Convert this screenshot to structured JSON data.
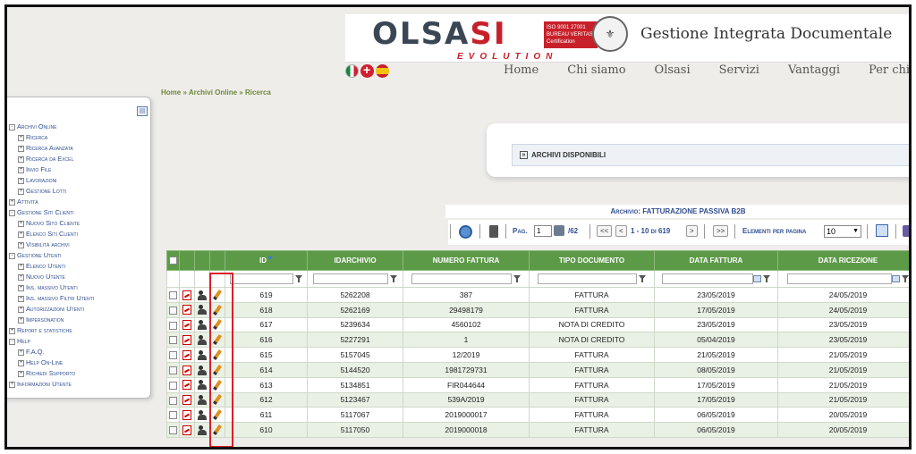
{
  "header": {
    "logo_main": "OLSA",
    "logo_accent": "SI",
    "logo_sub": "EVOLUTION",
    "cert_text": "ISO 9001 27001 BUREAU VERITAS Certification",
    "app_title": "Gestione Integrata Documentale"
  },
  "nav": {
    "items": [
      "Home",
      "Chi siamo",
      "Olsasi",
      "Servizi",
      "Vantaggi",
      "Per chi"
    ]
  },
  "breadcrumb": "Home » Archivi Online » Ricerca",
  "sidebar": {
    "items": [
      {
        "label": "Archivi Online",
        "level": 0,
        "sign": "-"
      },
      {
        "label": "Ricerca",
        "level": 1,
        "sign": "+"
      },
      {
        "label": "Ricerca Avanzata",
        "level": 1,
        "sign": "+"
      },
      {
        "label": "Ricerca da Excel",
        "level": 1,
        "sign": "+"
      },
      {
        "label": "Invio File",
        "level": 1,
        "sign": "+"
      },
      {
        "label": "Lavorazioni",
        "level": 1,
        "sign": "+"
      },
      {
        "label": "Gestione Lotti",
        "level": 1,
        "sign": "+"
      },
      {
        "label": "Attività",
        "level": 0,
        "sign": "+"
      },
      {
        "label": "Gestione Siti Clienti",
        "level": 0,
        "sign": "-"
      },
      {
        "label": "Nuovo Sito Cliente",
        "level": 1,
        "sign": "+"
      },
      {
        "label": "Elenco Siti Clienti",
        "level": 1,
        "sign": "+"
      },
      {
        "label": "Visibilità archivi",
        "level": 1,
        "sign": "+"
      },
      {
        "label": "Gestione Utenti",
        "level": 0,
        "sign": "-"
      },
      {
        "label": "Elenco Utenti",
        "level": 1,
        "sign": "+"
      },
      {
        "label": "Nuovo Utente",
        "level": 1,
        "sign": "+"
      },
      {
        "label": "Ins. massivo Utenti",
        "level": 1,
        "sign": "+"
      },
      {
        "label": "Ins. massivo Filtri Utenti",
        "level": 1,
        "sign": "+"
      },
      {
        "label": "Autorizzazioni Utenti",
        "level": 1,
        "sign": "+"
      },
      {
        "label": "Impersonation",
        "level": 1,
        "sign": "+"
      },
      {
        "label": "Report e statistiche",
        "level": 0,
        "sign": "+"
      },
      {
        "label": "Help",
        "level": 0,
        "sign": "-"
      },
      {
        "label": "F.A.Q.",
        "level": 1,
        "sign": "+"
      },
      {
        "label": "Help On-Line",
        "level": 1,
        "sign": "+"
      },
      {
        "label": "Richiedi Supporto",
        "level": 1,
        "sign": "+"
      },
      {
        "label": "Informazioni Utente",
        "level": 0,
        "sign": "+"
      }
    ]
  },
  "archivi": {
    "label": "ARCHIVI DISPONIBILI"
  },
  "archive_selected": {
    "prefix": "Archivio:",
    "name": "FATTURAZIONE PASSIVA B2B"
  },
  "pager": {
    "pag_label": "Pag.",
    "page": "1",
    "total_pages": "/62",
    "first": "<<",
    "prev": "<",
    "range": "1 - 10 di 619",
    "next": ">",
    "last": ">>",
    "per_page_label": "Elementi per pagina",
    "per_page": "10"
  },
  "table": {
    "columns": [
      "ID",
      "IDARCHIVIO",
      "NUMERO FATTURA",
      "TIPO DOCUMENTO",
      "DATA FATTURA",
      "DATA RICEZIONE"
    ],
    "rows": [
      [
        "619",
        "5262208",
        "387",
        "FATTURA",
        "23/05/2019",
        "24/05/2019"
      ],
      [
        "618",
        "5262169",
        "29498179",
        "FATTURA",
        "17/05/2019",
        "24/05/2019"
      ],
      [
        "617",
        "5239634",
        "4560102",
        "NOTA DI CREDITO",
        "23/05/2019",
        "23/05/2019"
      ],
      [
        "616",
        "5227291",
        "1",
        "NOTA DI CREDITO",
        "05/04/2019",
        "23/05/2019"
      ],
      [
        "615",
        "5157045",
        "12/2019",
        "FATTURA",
        "21/05/2019",
        "21/05/2019"
      ],
      [
        "614",
        "5144520",
        "1981729731",
        "FATTURA",
        "08/05/2019",
        "21/05/2019"
      ],
      [
        "613",
        "5134851",
        "FIR044644",
        "FATTURA",
        "17/05/2019",
        "21/05/2019"
      ],
      [
        "612",
        "5123467",
        "539A/2019",
        "FATTURA",
        "17/05/2019",
        "21/05/2019"
      ],
      [
        "611",
        "5117067",
        "2019000017",
        "FATTURA",
        "06/05/2019",
        "20/05/2019"
      ],
      [
        "610",
        "5117050",
        "2019000018",
        "FATTURA",
        "06/05/2019",
        "20/05/2019"
      ]
    ]
  },
  "colors": {
    "header_green": "#5d9a48",
    "row_alt": "#e9f0e4",
    "highlight_red": "#d9202a",
    "menu_blue": "#2f4d92"
  }
}
